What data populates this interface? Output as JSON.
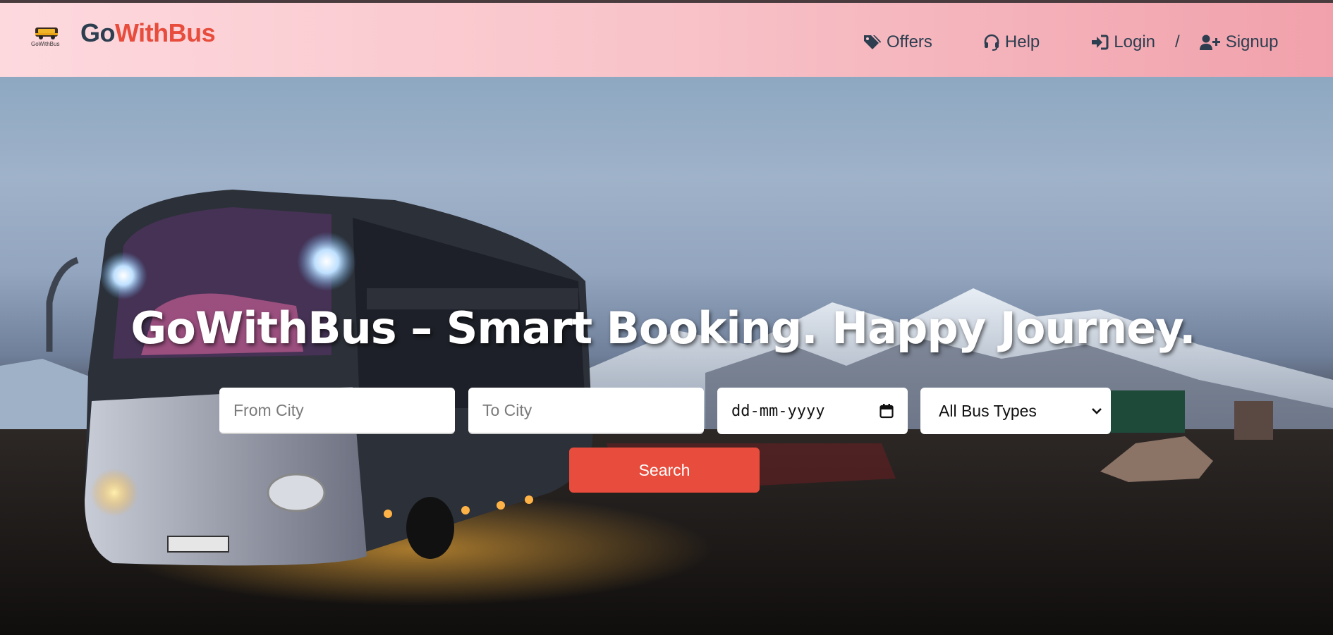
{
  "brand": {
    "name_part1": "Go",
    "name_part2": "WithBus",
    "logo_text": "GoWithBus"
  },
  "nav": {
    "offers": "Offers",
    "help": "Help",
    "login": "Login",
    "separator": "/",
    "signup": "Signup"
  },
  "hero": {
    "headline": "GoWithBus – Smart Booking. Happy Journey.",
    "from_placeholder": "From City",
    "to_placeholder": "To City",
    "date_placeholder": "dd-mm-yyyy",
    "bus_type_selected": "All Bus Types",
    "search_label": "Search"
  },
  "colors": {
    "accent": "#e74c3c",
    "brand_dark": "#2c3e50"
  }
}
